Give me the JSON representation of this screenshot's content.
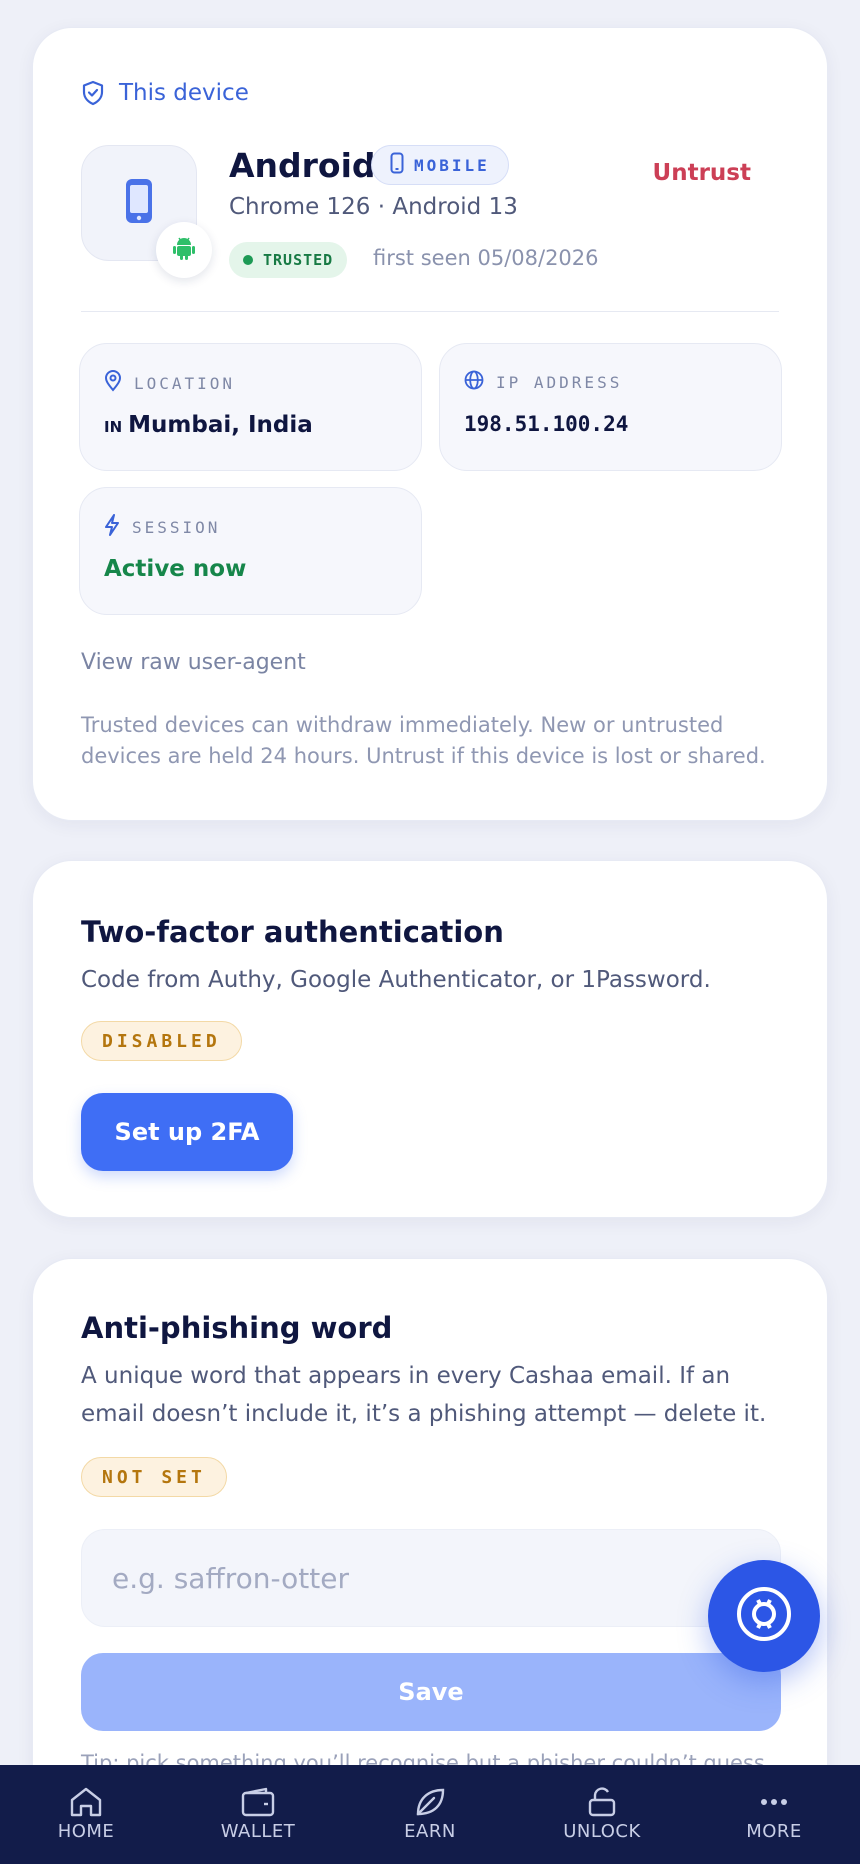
{
  "device": {
    "section_label": "This device",
    "name": "Android",
    "type_badge": "MOBILE",
    "untrust_label": "Untrust",
    "subtitle": "Chrome 126 · Android 13",
    "status": "TRUSTED",
    "first_seen": "first seen 05/08/2026",
    "location_label": "LOCATION",
    "location_flag": "IN",
    "location_value": "Mumbai, India",
    "ip_label": "IP ADDRESS",
    "ip_value": "198.51.100.24",
    "session_label": "SESSION",
    "session_value": "Active now",
    "raw_ua_link": "View raw user-agent",
    "note": "Trusted devices can withdraw immediately. New or untrusted devices are held 24 hours. Untrust if this device is lost or shared."
  },
  "two_factor": {
    "title": "Two-factor authentication",
    "description": "Code from Authy, Google Authenticator, or 1Password.",
    "status": "DISABLED",
    "button": "Set up 2FA"
  },
  "anti_phishing": {
    "title": "Anti-phishing word",
    "description": "A unique word that appears in every Cashaa email. If an email doesn’t include it, it’s a phishing attempt — delete it.",
    "status": "NOT SET",
    "placeholder": "e.g. saffron-otter",
    "save_label": "Save",
    "tip": "Tip: pick something you’ll recognise but a phisher couldn’t guess."
  },
  "nav": {
    "home": "HOME",
    "wallet": "WALLET",
    "earn": "EARN",
    "unlock": "UNLOCK",
    "more": "MORE"
  },
  "colors": {
    "accent": "#3f6ef5",
    "danger": "#cc3f56",
    "success": "#16864a",
    "warning": "#b4760e",
    "nav_bg": "#121c4a"
  }
}
